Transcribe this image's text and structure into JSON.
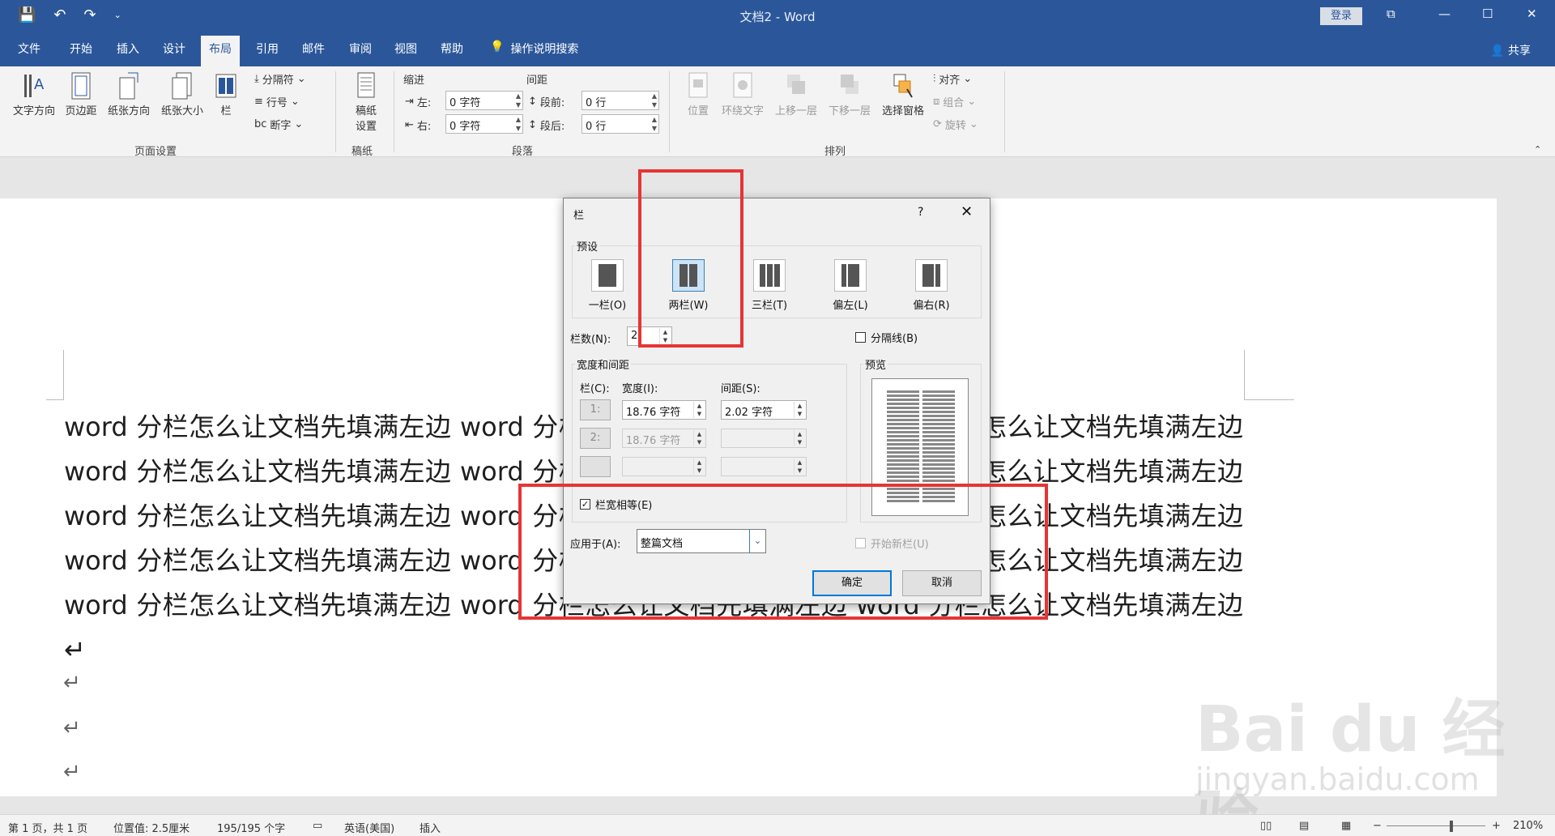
{
  "titlebar": {
    "doc_title": "文档2  -  Word",
    "login": "登录",
    "qat_save": "💾",
    "qat_undo": "↶",
    "qat_redo": "↷",
    "qat_more": "⌄",
    "restore": "⧉",
    "minimize": "—",
    "maximize": "☐",
    "close": "✕"
  },
  "tabs": {
    "file": "文件",
    "home": "开始",
    "insert": "插入",
    "design": "设计",
    "layout": "布局",
    "references": "引用",
    "mailings": "邮件",
    "review": "审阅",
    "view": "视图",
    "help": "帮助",
    "tell_me": "操作说明搜索",
    "share": "共享"
  },
  "ribbon": {
    "text_direction": "文字方向",
    "margins": "页边距",
    "orientation": "纸张方向",
    "size": "纸张大小",
    "columns": "栏",
    "breaks": "分隔符",
    "line_numbers": "行号",
    "hyphenation": "断字",
    "page_setup_group": "页面设置",
    "manuscript": "稿纸\n设置",
    "manuscript_group": "稿纸",
    "indent_label": "缩进",
    "spacing_label": "间距",
    "indent_left_label": "左:",
    "indent_left_value": "0 字符",
    "indent_right_label": "右:",
    "indent_right_value": "0 字符",
    "space_before_label": "段前:",
    "space_before_value": "0 行",
    "space_after_label": "段后:",
    "space_after_value": "0 行",
    "paragraph_group": "段落",
    "position": "位置",
    "wrap_text": "环绕文字",
    "bring_forward": "上移一层",
    "send_backward": "下移一层",
    "selection_pane": "选择窗格",
    "align": "对齐",
    "group": "组合",
    "rotate": "旋转",
    "arrange_group": "排列"
  },
  "document": {
    "body_text": "word 分栏怎么让文档先填满左边 word 分栏怎么让文档先填满左边 word 分栏怎么让文档先填满左边 word 分栏怎么让文档先填满左边 word 分栏怎么让文档先填满左边 word 分栏怎么让文档先填满左边 word 分栏怎么让文档先填满左边 word 分栏怎么让文档先填满左边 word 分栏怎么让文档先填满左边 word 分栏怎么让文档先填满左边 word 分栏怎么让文档先填满左边 word 分栏怎么让文档先填满左边 word 分栏怎么让文档先填满左边 word 分栏怎么让文档先填满左边 word 分栏怎么让文档先填满左边↵",
    "para_mark": "↵"
  },
  "dialog": {
    "title": "栏",
    "help": "?",
    "close": "✕",
    "presets_legend": "预设",
    "preset_one": "一栏(O)",
    "preset_two": "两栏(W)",
    "preset_three": "三栏(T)",
    "preset_left": "偏左(L)",
    "preset_right": "偏右(R)",
    "num_cols_label": "栏数(N):",
    "num_cols_value": "2",
    "line_between": "分隔线(B)",
    "width_spacing_legend": "宽度和间距",
    "col_header": "栏(C):",
    "width_header": "宽度(I):",
    "spacing_header": "间距(S):",
    "row1_num": "1:",
    "row1_width": "18.76 字符",
    "row1_spacing": "2.02 字符",
    "row2_num": "2:",
    "row2_width": "18.76 字符",
    "row2_spacing": "",
    "preview_legend": "预览",
    "equal_width": "栏宽相等(E)",
    "equal_width_check": "✓",
    "apply_to_label": "应用于(A):",
    "apply_to_value": "整篇文档",
    "start_new_col": "开始新栏(U)",
    "ok": "确定",
    "cancel": "取消"
  },
  "statusbar": {
    "page": "第 1 页，共 1 页",
    "position": "位置值: 2.5厘米",
    "words": "195/195 个字",
    "language": "英语(美国)",
    "mode": "插入",
    "zoom": "210%"
  },
  "watermark": {
    "brand": "Bai du 经验",
    "url": "jingyan.baidu.com"
  },
  "colors": {
    "accent": "#2b579a",
    "annotation": "#e53535"
  }
}
